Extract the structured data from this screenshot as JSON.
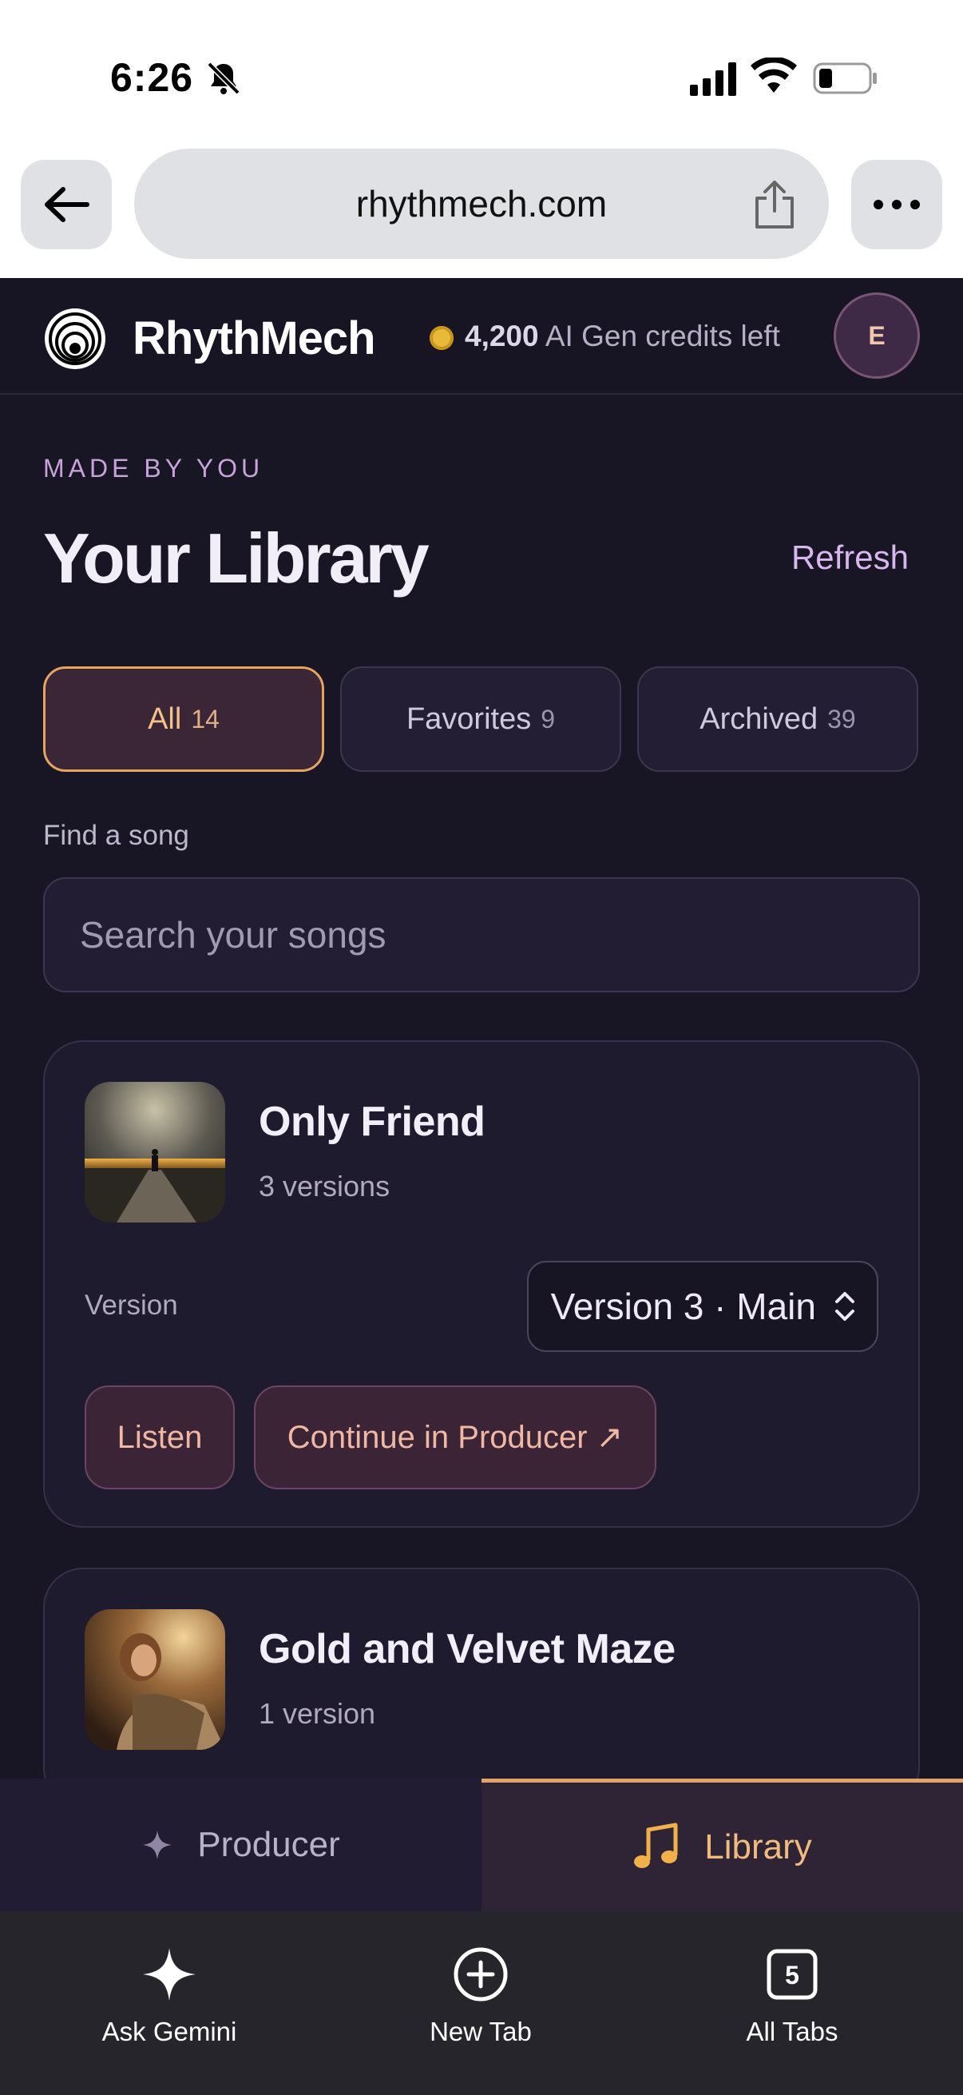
{
  "status_bar": {
    "time": "6:26"
  },
  "browser": {
    "url": "rhythmech.com"
  },
  "header": {
    "brand": "RhythMech",
    "credits_amount": "4,200",
    "credits_text": "AI Gen credits left",
    "avatar_initial": "E"
  },
  "library": {
    "eyebrow": "MADE BY YOU",
    "title": "Your Library",
    "refresh_label": "Refresh",
    "tabs": [
      {
        "label": "All",
        "count": "14"
      },
      {
        "label": "Favorites",
        "count": "9"
      },
      {
        "label": "Archived",
        "count": "39"
      }
    ],
    "find_label": "Find a song",
    "search_placeholder": "Search your songs"
  },
  "songs": [
    {
      "title": "Only Friend",
      "versions": "3 versions",
      "version_label": "Version",
      "selected_version": "Version 3 · Main",
      "listen_label": "Listen",
      "continue_label": "Continue in Producer ↗"
    },
    {
      "title": "Gold and Velvet Maze",
      "versions": "1 version"
    }
  ],
  "app_nav": {
    "producer": "Producer",
    "library": "Library"
  },
  "browser_toolbar": {
    "ask_gemini": "Ask Gemini",
    "new_tab": "New Tab",
    "all_tabs": "All Tabs",
    "tab_count": "5"
  },
  "colors": {
    "accent": "#e6a55e",
    "background": "#181525",
    "link": "#d8b7ef"
  }
}
